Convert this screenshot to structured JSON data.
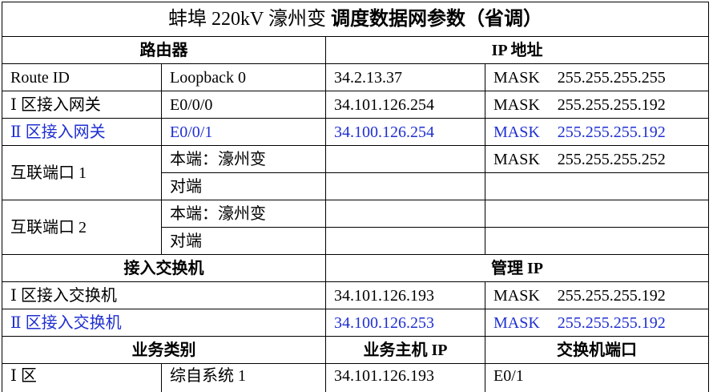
{
  "title": {
    "main": "蚌埠 220kV 濠州变",
    "bold": "调度数据网参数（省调）"
  },
  "router_section": {
    "left_header": "路由器",
    "right_header": "IP 地址"
  },
  "router_rows": [
    {
      "name": "Route ID",
      "port": "Loopback 0",
      "ip": "34.2.13.37",
      "mask_label": "MASK",
      "mask": "255.255.255.255"
    },
    {
      "name": "Ⅰ 区接入网关",
      "port": "E0/0/0",
      "ip": "34.101.126.254",
      "mask_label": "MASK",
      "mask": "255.255.255.192"
    },
    {
      "name": "Ⅱ 区接入网关",
      "port": "E0/0/1",
      "ip": "34.100.126.254",
      "mask_label": "MASK",
      "mask": "255.255.255.192"
    }
  ],
  "interconnect": [
    {
      "name": "互联端口 1",
      "local": "本端：濠州变",
      "remote": "对端",
      "mask_label": "MASK",
      "mask": "255.255.255.252"
    },
    {
      "name": "互联端口 2",
      "local": "本端：濠州变",
      "remote": "对端"
    }
  ],
  "switch_section": {
    "left_header": "接入交换机",
    "right_header": "管理 IP"
  },
  "switch_rows": [
    {
      "name": "Ⅰ 区接入交换机",
      "ip": "34.101.126.193",
      "mask_label": "MASK",
      "mask": "255.255.255.192"
    },
    {
      "name": "Ⅱ 区接入交换机",
      "ip": "34.100.126.253",
      "mask_label": "MASK",
      "mask": "255.255.255.192"
    }
  ],
  "service_section": {
    "col1": "业务类别",
    "col2": "业务主机 IP",
    "col3": "交换机端口"
  },
  "service_rows": [
    {
      "zone": "Ⅰ 区",
      "system": "综自系统 1",
      "ip": "34.101.126.193",
      "port": "E0/1"
    }
  ],
  "colors": {
    "zone2_text": "#1f2fd1",
    "border": "#000000"
  }
}
